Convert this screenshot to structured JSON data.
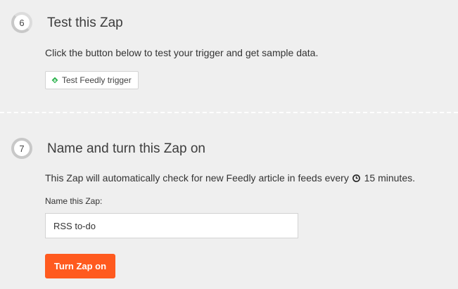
{
  "step6": {
    "number": "6",
    "title": "Test this Zap",
    "description": "Click the button below to test your trigger and get sample data.",
    "test_button_label": "Test Feedly trigger",
    "icon": "feedly-icon"
  },
  "step7": {
    "number": "7",
    "title": "Name and turn this Zap on",
    "description_before": "This Zap will automatically check for new Feedly article in feeds every",
    "description_after": "15 minutes.",
    "clock_icon": "clock-icon",
    "field_label": "Name this Zap:",
    "zap_name_value": "RSS to-do",
    "turn_on_label": "Turn Zap on"
  },
  "colors": {
    "background": "#efefef",
    "accent": "#ff5a1f",
    "feedly_green": "#2bb24c"
  }
}
